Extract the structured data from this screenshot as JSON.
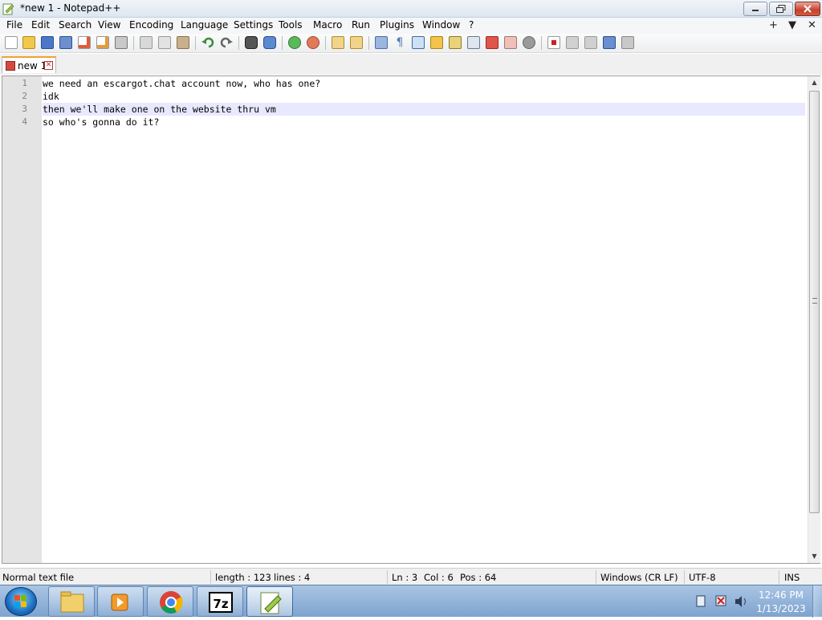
{
  "window": {
    "title": "*new 1 - Notepad++"
  },
  "menu": {
    "items": [
      "File",
      "Edit",
      "Search",
      "View",
      "Encoding",
      "Language",
      "Settings",
      "Tools",
      "Macro",
      "Run",
      "Plugins",
      "Window",
      "?"
    ],
    "right": [
      "+",
      "▼",
      "✕"
    ]
  },
  "tabs": [
    {
      "label": "new 1"
    }
  ],
  "editor": {
    "line_numbers": [
      "1",
      "2",
      "3",
      "4"
    ],
    "lines": [
      "we need an escargot.chat account now, who has one?",
      "idk",
      "then we'll make one on the website thru vm",
      "so who's gonna do it?"
    ],
    "current_line": 3
  },
  "status": {
    "file_type": "Normal text file",
    "length": "length : 123",
    "lines": "lines : 4",
    "ln": "Ln : 3",
    "col": "Col : 6",
    "pos": "Pos : 64",
    "eol": "Windows (CR LF)",
    "encoding": "UTF-8",
    "mode": "INS"
  },
  "taskbar": {
    "apps": [
      "windows-explorer",
      "media-player",
      "chrome",
      "7-zip",
      "notepad++"
    ],
    "clock_time": "12:46 PM",
    "clock_date": "1/13/2023"
  },
  "colors": {
    "current_line": "#e8e8ff",
    "gutter": "#e4e4e4",
    "tab_accent": "#f5a030"
  }
}
